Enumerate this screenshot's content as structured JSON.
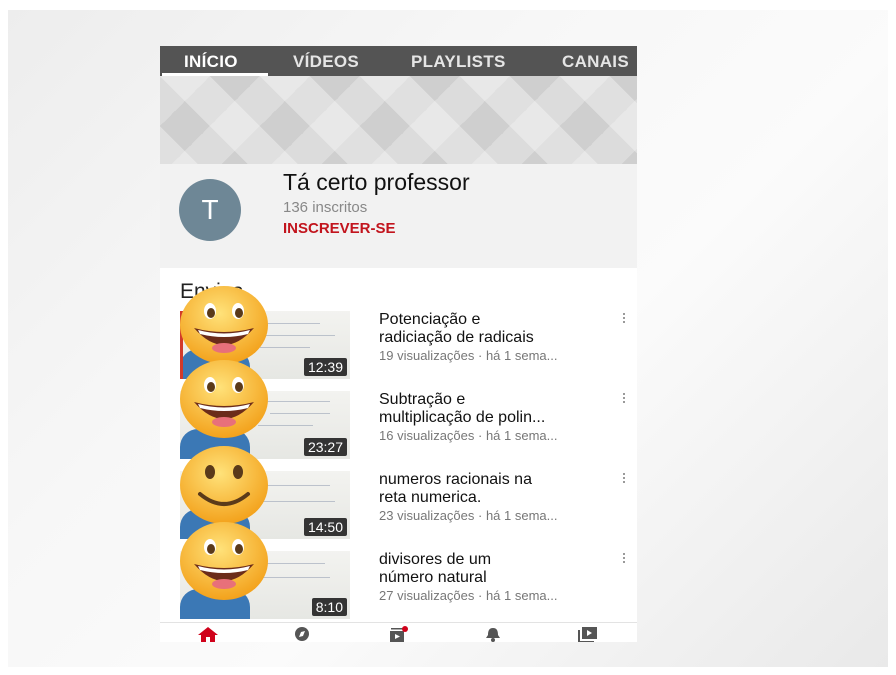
{
  "tabs": [
    {
      "label": "INÍCIO",
      "active": true
    },
    {
      "label": "VÍDEOS",
      "active": false
    },
    {
      "label": "PLAYLISTS",
      "active": false
    },
    {
      "label": "CANAIS",
      "active": false
    }
  ],
  "channel": {
    "avatar_letter": "T",
    "name": "Tá certo professor",
    "subscribers": "136 inscritos",
    "subscribe_label": "INSCREVER-SE"
  },
  "uploads": {
    "section_title": "Envios",
    "videos": [
      {
        "title_line1": "Potenciação e",
        "title_line2": "radiciação de radicais",
        "meta": "19 visualizações · há 1 sema...",
        "duration": "12:39"
      },
      {
        "title_line1": "Subtração e",
        "title_line2": "multiplicação de polin...",
        "meta": "16 visualizações · há 1 sema...",
        "duration": "23:27"
      },
      {
        "title_line1": "numeros racionais na",
        "title_line2": "reta numerica.",
        "meta": "23 visualizações · há 1 sema...",
        "duration": "14:50"
      },
      {
        "title_line1": "divisores de um",
        "title_line2": "número natural",
        "meta": "27 visualizações · há 1 sema...",
        "duration": "8:10"
      }
    ]
  },
  "bottom_nav": [
    {
      "icon": "home-icon",
      "active": true
    },
    {
      "icon": "explore-icon",
      "active": false
    },
    {
      "icon": "subscriptions-icon",
      "active": false
    },
    {
      "icon": "notifications-icon",
      "active": false
    },
    {
      "icon": "library-icon",
      "active": false
    }
  ],
  "colors": {
    "tab_bar": "#545454",
    "subscribe": "#c2141d",
    "avatar": "#6e8796",
    "home_active": "#d0021b"
  }
}
